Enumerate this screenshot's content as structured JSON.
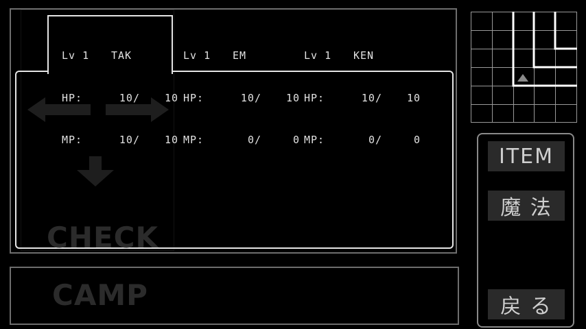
{
  "party": [
    {
      "level_label": "Lv 1",
      "name": "TAK",
      "hp_label": "HP:",
      "hp": "10/",
      "hp_max": "10",
      "mp_label": "MP:",
      "mp": "10/",
      "mp_max": "10"
    },
    {
      "level_label": "Lv 1",
      "name": "EM",
      "hp_label": "HP:",
      "hp": "10/",
      "hp_max": "10",
      "mp_label": "MP:",
      "mp": "0/",
      "mp_max": "0"
    },
    {
      "level_label": "Lv 1",
      "name": "KEN",
      "hp_label": "HP:",
      "hp": "10/",
      "hp_max": "10",
      "mp_label": "MP:",
      "mp": "0/",
      "mp_max": "0"
    }
  ],
  "background_controls": {
    "check_label": "CHECK",
    "camp_label": "CAMP"
  },
  "menu": {
    "item_label": "ITEM",
    "magic_label": "魔 法",
    "back_label": "戻 る"
  },
  "colors": {
    "frame": "#6e6e6e",
    "panel_border": "#e6e6e6",
    "button_bg": "#2a2a2a",
    "map_grid": "#9a9a9a",
    "map_wall": "#ffffff",
    "player_marker": "#8a8a8a"
  }
}
